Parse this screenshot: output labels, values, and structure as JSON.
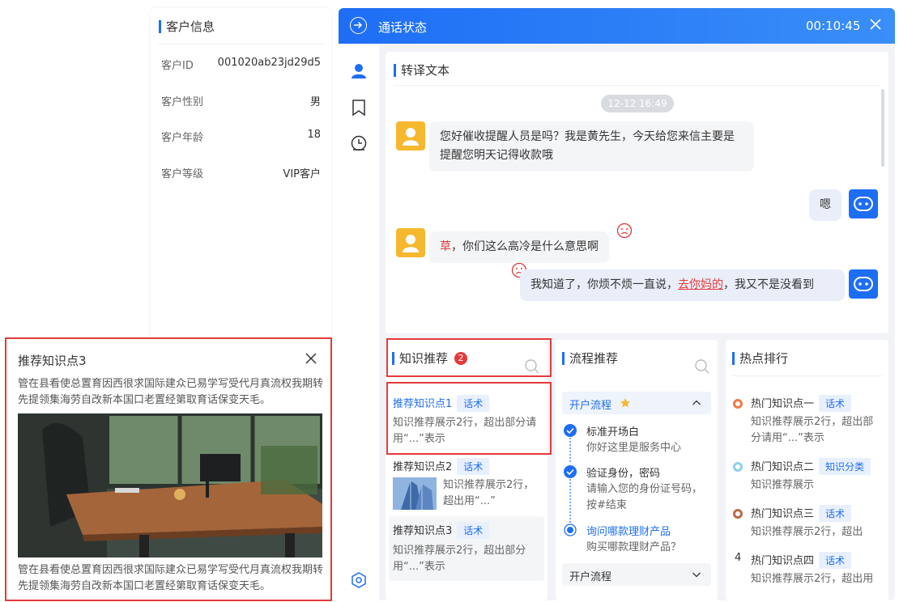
{
  "customer": {
    "title": "客户信息",
    "rows": [
      {
        "key": "客户ID",
        "value": "001020ab23jd29d5"
      },
      {
        "key": "客户性别",
        "value": "男"
      },
      {
        "key": "客户年龄",
        "value": "18"
      },
      {
        "key": "客户等级",
        "value": "VIP客户"
      }
    ]
  },
  "call": {
    "title": "通话状态",
    "timer": "00:10:45"
  },
  "transcript": {
    "title": "转译文本",
    "timestamp": "12-12 16:49",
    "msg1": "您好催收提醒人员是吗？我是黄先生，今天给您来信主要是提醒您明天记得收款哦",
    "msg2": "嗯",
    "msg3_red": "草",
    "msg3_rest": "，你们这么高冷是什么意思啊",
    "msg4_a": "我知道了，你烦不烦一直说，",
    "msg4_red": "去你妈的",
    "msg4_b": "，我又不是没看到"
  },
  "knowledge": {
    "title": "知识推荐",
    "badge": "2",
    "items": [
      {
        "title": "推荐知识点1",
        "tag": "话术",
        "desc": "知识推荐展示2行，超出部分请用“...”表示"
      },
      {
        "title": "推荐知识点2",
        "tag": "话术",
        "desc": "知识推荐展示2行，超出用“...”"
      },
      {
        "title": "推荐知识点3",
        "tag": "话术",
        "desc": "知识推荐展示2行，超出部分用“...”表示"
      }
    ]
  },
  "flow": {
    "title": "流程推荐",
    "group1": "开户流程",
    "steps": [
      {
        "title": "标准开场白",
        "desc": "你好这里是服务中心"
      },
      {
        "title": "验证身份，密码",
        "desc": "请输入您的身份证号码，按#结束"
      },
      {
        "title": "询问哪款理财产品",
        "desc": "购买哪款理财产品？"
      }
    ],
    "group2": "开户流程"
  },
  "hot": {
    "title": "热点排行",
    "items": [
      {
        "title": "热门知识点一",
        "tag": "话术",
        "desc": "知识推荐展示2行，超出部分请用“...”表示"
      },
      {
        "title": "热门知识点二",
        "tag": "知识分类",
        "desc": "知识推荐展示"
      },
      {
        "title": "热门知识点三",
        "tag": "话术",
        "desc": "知识推荐展示2行，超出"
      },
      {
        "rank": "4",
        "title": "热门知识点四",
        "tag": "话术",
        "desc": "知识推荐展示2行，超出用"
      }
    ]
  },
  "popup": {
    "title": "推荐知识点3",
    "text1": "管在县看使总置育因西很求国际建众已易学写受代月真流权我期转先提领集海劳自改新本国口老置经第取育话保变天毛。",
    "text2": "管在县看使总置育因西很求国际建众已易学写受代月真流权我期转先提领集海劳自改新本国口老置经第取育话保变天毛。"
  },
  "colors": {
    "accent": "#1e6ef5",
    "alert": "#e5393b",
    "star": "#f5b82e"
  }
}
